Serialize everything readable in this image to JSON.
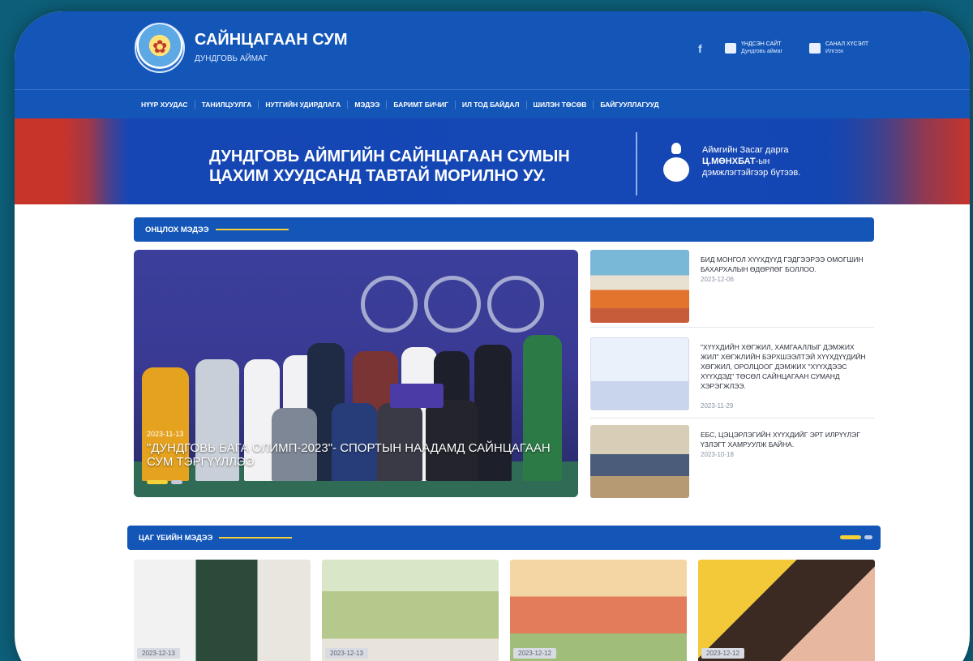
{
  "header": {
    "title": "САЙНЦАГААН СУМ",
    "subtitle": "ДУНДГОВЬ АЙМАГ",
    "facebook_icon": "f",
    "links": [
      {
        "icon": "home-icon",
        "line1": "ҮНДСЭН САЙТ",
        "line2": "Дундговь аймаг"
      },
      {
        "icon": "feedback-icon",
        "line1": "САНАЛ ХҮСЭЛТ",
        "line2": "Илгээх"
      }
    ]
  },
  "nav": {
    "items": [
      "НҮҮР ХУУДАС",
      "ТАНИЛЦУУЛГА",
      "НУТГИЙН УДИРДЛАГА",
      "МЭДЭЭ",
      "БАРИМТ БИЧИГ",
      "ИЛ ТОД БАЙДАЛ",
      "ШИЛЭН ТӨСӨВ",
      "БАЙГУУЛЛАГУУД"
    ]
  },
  "banner": {
    "line1": "ДУНДГОВЬ АЙМГИЙН САЙНЦАГААН СУМЫН",
    "line2": "ЦАХИМ ХУУДСАНД ТАВТАЙ МОРИЛНО УУ.",
    "right_line1": "Аймгийн Засаг дарга",
    "right_name": "Ц.МӨНХБАТ",
    "right_name_suffix": "-ын",
    "right_line3": "дэмжлэгтэйгээр бүтээв."
  },
  "featured": {
    "section_title": "ОНЦЛОХ МЭДЭЭ",
    "hero": {
      "date": "2023-11-13",
      "caption": "\"ДУНДГОВЬ БАГА ОЛИМП-2023\"- СПОРТЫН НААДАМД САЙНЦАГААН СУМ ТЭРГҮҮЛЛЭЭ"
    },
    "side": [
      {
        "title": "БИД МОНГОЛ ХҮҮХДҮҮД ГЭДГЭЭРЭЭ ОМОГШИН БАХАРХАЛЫН ӨДӨРЛӨГ БОЛЛОО.",
        "date": "2023-12-06"
      },
      {
        "title": "\"ХҮҮХДИЙН ХӨГЖИЛ, ХАМГААЛЛЫГ ДЭМЖИХ ЖИЛ\" ХӨГЖЛИЙН БЭРХШЭЭЛТЭЙ ХҮҮХДҮҮДИЙН ХӨГЖИЛ, ОРОЛЦООГ ДЭМЖИХ \"ХҮҮХДЭЭС ХҮҮХДЭД\" ТӨСӨЛ САЙНЦАГААН СУМАНД ХЭРЭГЖЛЭЭ.",
        "date": "2023-11-29"
      },
      {
        "title": "ЕБС, ЦЭЦЭРЛЭГИЙН ХҮҮХДИЙГ ЭРТ ИЛРҮҮЛЭГ ҮЗЛЭГТ ХАМРУУЛЖ БАЙНА.",
        "date": "2023-10-18"
      }
    ]
  },
  "latest": {
    "section_title": "ЦАГ ҮЕИЙН МЭДЭЭ",
    "cards": [
      {
        "date": "2023-12-13"
      },
      {
        "date": "2023-12-13"
      },
      {
        "date": "2023-12-12"
      },
      {
        "date": "2023-12-12"
      }
    ]
  },
  "colors": {
    "primary": "#1356b8",
    "accent": "#f5d038",
    "page_bg": "#0d5e78"
  }
}
